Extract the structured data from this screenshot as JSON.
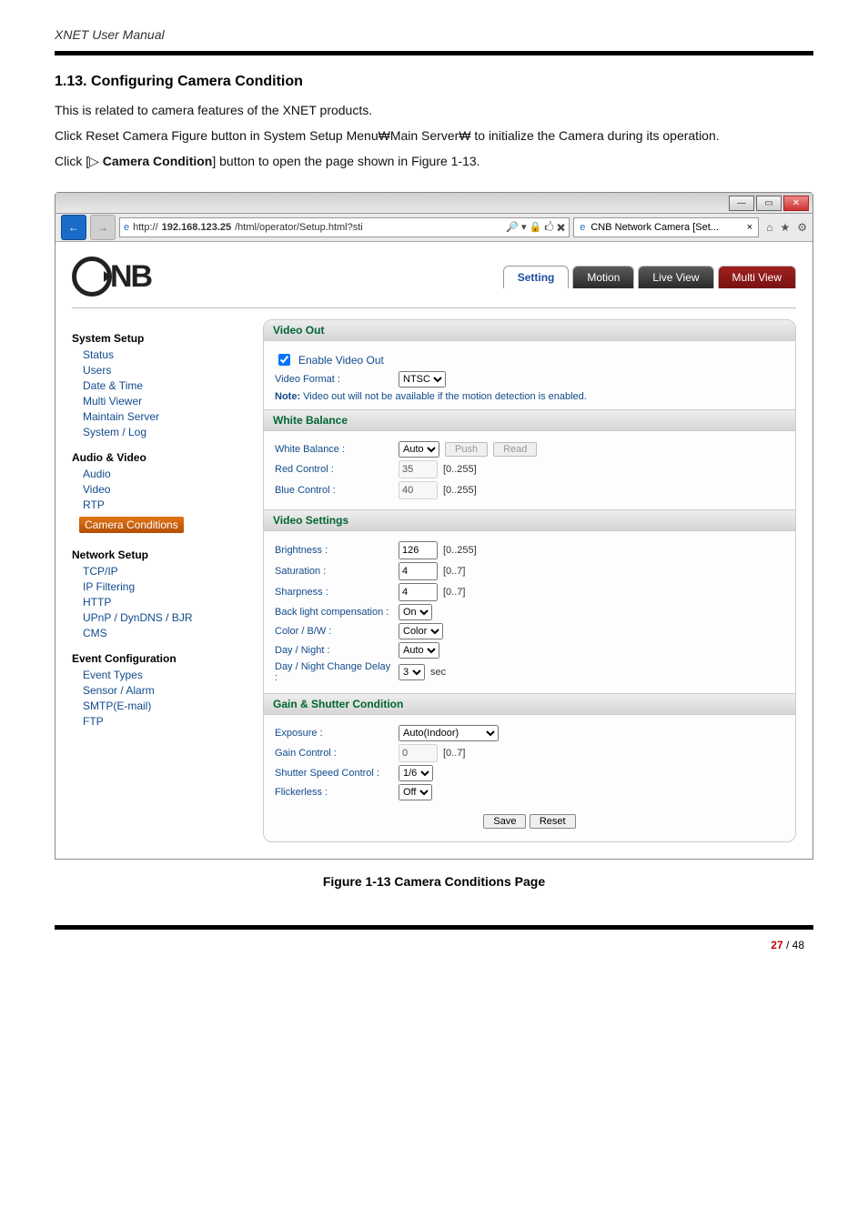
{
  "doc": {
    "header": "XNET User Manual",
    "section_title": "1.13. Configuring Camera Condition",
    "para1": "This is related to camera features of the XNET products.",
    "para2": "Click Reset Camera Figure button in System Setup Menu₩Main Server₩ to initialize the Camera during its operation.",
    "para3_pre": "Click [▷ ",
    "para3_bold": "Camera Condition",
    "para3_post": "] button to open the page shown in Figure 1-13.",
    "figure_caption": "Figure 1-13 Camera Conditions Page",
    "page_cur": "27",
    "page_sep": " / ",
    "page_total": "48"
  },
  "browser": {
    "url_left": "http://",
    "url_host": "192.168.123.25",
    "url_rest": "/html/operator/Setup.html?sti",
    "search_glyphs": "🔎 ▾  🔒 🖒 ✖",
    "tab_title": "CNB Network Camera [Set...",
    "tab_close": "×",
    "ie_glyph": "e",
    "home": "⌂",
    "star": "★",
    "gear": "⚙",
    "min": "—",
    "max": "▭",
    "close": "✕",
    "back": "←",
    "fwd": "→"
  },
  "logo": {
    "text": "NB"
  },
  "tabs": {
    "setting": "Setting",
    "motion": "Motion",
    "live": "Live View",
    "multi": "Multi View"
  },
  "sidebar": {
    "g1": "System Setup",
    "g1_items": [
      "Status",
      "Users",
      "Date & Time",
      "Multi Viewer",
      "Maintain Server",
      "System / Log"
    ],
    "g2": "Audio & Video",
    "g2_items": [
      "Audio",
      "Video",
      "RTP"
    ],
    "g2_sel": "Camera Conditions",
    "g3": "Network Setup",
    "g3_items": [
      "TCP/IP",
      "IP Filtering",
      "HTTP",
      "UPnP / DynDNS / BJR",
      "CMS"
    ],
    "g4": "Event Configuration",
    "g4_items": [
      "Event Types",
      "Sensor / Alarm",
      "SMTP(E-mail)",
      "FTP"
    ]
  },
  "panel": {
    "video_out": {
      "head": "Video Out",
      "checkbox": "Enable Video Out",
      "format_label": "Video Format :",
      "format_value": "NTSC",
      "note_b": "Note:",
      "note": " Video out will not be available if the motion detection is enabled."
    },
    "white_balance": {
      "head": "White Balance",
      "wb_label": "White Balance :",
      "wb_value": "Auto",
      "push": "Push",
      "read": "Read",
      "red_label": "Red Control :",
      "red_value": "35",
      "red_range": "[0..255]",
      "blue_label": "Blue Control :",
      "blue_value": "40",
      "blue_range": "[0..255]"
    },
    "video_settings": {
      "head": "Video Settings",
      "bright_label": "Brightness :",
      "bright_value": "126",
      "bright_range": "[0..255]",
      "sat_label": "Saturation :",
      "sat_value": "4",
      "sat_range": "[0..7]",
      "sharp_label": "Sharpness :",
      "sharp_value": "4",
      "sharp_range": "[0..7]",
      "bl_label": "Back light compensation :",
      "bl_value": "On",
      "cbw_label": "Color / B/W :",
      "cbw_value": "Color",
      "dn_label": "Day / Night :",
      "dn_value": "Auto",
      "delay_label": "Day / Night Change Delay :",
      "delay_value": "3",
      "delay_unit": "sec"
    },
    "gain_shutter": {
      "head": "Gain & Shutter Condition",
      "exp_label": "Exposure :",
      "exp_value": "Auto(Indoor)",
      "gain_label": "Gain Control :",
      "gain_value": "0",
      "gain_range": "[0..7]",
      "shut_label": "Shutter Speed Control :",
      "shut_value": "1/6",
      "flick_label": "Flickerless :",
      "flick_value": "Off"
    },
    "buttons": {
      "save": "Save",
      "reset": "Reset"
    }
  }
}
